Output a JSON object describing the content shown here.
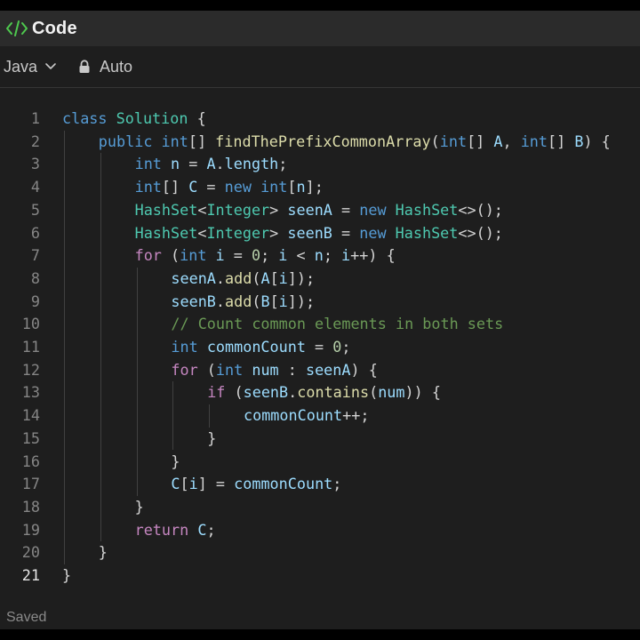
{
  "window": {
    "title": "Code",
    "icon": "code-brackets-icon"
  },
  "toolbar": {
    "language": "Java",
    "mode_label": "Auto",
    "lock_icon": "lock-icon",
    "chevron_icon": "chevron-down-icon"
  },
  "editor": {
    "active_line": 21,
    "lines": [
      {
        "n": "1",
        "indent": 0,
        "tokens": [
          [
            "kw",
            "class"
          ],
          [
            "plain",
            " "
          ],
          [
            "ty",
            "Solution"
          ],
          [
            "plain",
            " {"
          ]
        ]
      },
      {
        "n": "2",
        "indent": 1,
        "tokens": [
          [
            "kw",
            "public"
          ],
          [
            "plain",
            " "
          ],
          [
            "kw",
            "int"
          ],
          [
            "plain",
            "[] "
          ],
          [
            "fn",
            "findThePrefixCommonArray"
          ],
          [
            "plain",
            "("
          ],
          [
            "kw",
            "int"
          ],
          [
            "plain",
            "[] "
          ],
          [
            "var",
            "A"
          ],
          [
            "plain",
            ", "
          ],
          [
            "kw",
            "int"
          ],
          [
            "plain",
            "[] "
          ],
          [
            "var",
            "B"
          ],
          [
            "plain",
            ") {"
          ]
        ]
      },
      {
        "n": "3",
        "indent": 2,
        "tokens": [
          [
            "kw",
            "int"
          ],
          [
            "plain",
            " "
          ],
          [
            "var",
            "n"
          ],
          [
            "plain",
            " = "
          ],
          [
            "var",
            "A"
          ],
          [
            "plain",
            "."
          ],
          [
            "var",
            "length"
          ],
          [
            "plain",
            ";"
          ]
        ]
      },
      {
        "n": "4",
        "indent": 2,
        "tokens": [
          [
            "kw",
            "int"
          ],
          [
            "plain",
            "[] "
          ],
          [
            "var",
            "C"
          ],
          [
            "plain",
            " = "
          ],
          [
            "kw",
            "new"
          ],
          [
            "plain",
            " "
          ],
          [
            "kw",
            "int"
          ],
          [
            "plain",
            "["
          ],
          [
            "var",
            "n"
          ],
          [
            "plain",
            "];"
          ]
        ]
      },
      {
        "n": "5",
        "indent": 2,
        "tokens": [
          [
            "ty",
            "HashSet"
          ],
          [
            "plain",
            "<"
          ],
          [
            "ty",
            "Integer"
          ],
          [
            "plain",
            "> "
          ],
          [
            "var",
            "seenA"
          ],
          [
            "plain",
            " = "
          ],
          [
            "kw",
            "new"
          ],
          [
            "plain",
            " "
          ],
          [
            "ty",
            "HashSet"
          ],
          [
            "plain",
            "<>();"
          ]
        ]
      },
      {
        "n": "6",
        "indent": 2,
        "tokens": [
          [
            "ty",
            "HashSet"
          ],
          [
            "plain",
            "<"
          ],
          [
            "ty",
            "Integer"
          ],
          [
            "plain",
            "> "
          ],
          [
            "var",
            "seenB"
          ],
          [
            "plain",
            " = "
          ],
          [
            "kw",
            "new"
          ],
          [
            "plain",
            " "
          ],
          [
            "ty",
            "HashSet"
          ],
          [
            "plain",
            "<>();"
          ]
        ]
      },
      {
        "n": "7",
        "indent": 2,
        "tokens": [
          [
            "ctl",
            "for"
          ],
          [
            "plain",
            " ("
          ],
          [
            "kw",
            "int"
          ],
          [
            "plain",
            " "
          ],
          [
            "var",
            "i"
          ],
          [
            "plain",
            " = "
          ],
          [
            "num",
            "0"
          ],
          [
            "plain",
            "; "
          ],
          [
            "var",
            "i"
          ],
          [
            "plain",
            " < "
          ],
          [
            "var",
            "n"
          ],
          [
            "plain",
            "; "
          ],
          [
            "var",
            "i"
          ],
          [
            "plain",
            "++) {"
          ]
        ]
      },
      {
        "n": "8",
        "indent": 3,
        "tokens": [
          [
            "var",
            "seenA"
          ],
          [
            "plain",
            "."
          ],
          [
            "fn",
            "add"
          ],
          [
            "plain",
            "("
          ],
          [
            "var",
            "A"
          ],
          [
            "plain",
            "["
          ],
          [
            "var",
            "i"
          ],
          [
            "plain",
            "]);"
          ]
        ]
      },
      {
        "n": "9",
        "indent": 3,
        "tokens": [
          [
            "var",
            "seenB"
          ],
          [
            "plain",
            "."
          ],
          [
            "fn",
            "add"
          ],
          [
            "plain",
            "("
          ],
          [
            "var",
            "B"
          ],
          [
            "plain",
            "["
          ],
          [
            "var",
            "i"
          ],
          [
            "plain",
            "]);"
          ]
        ]
      },
      {
        "n": "10",
        "indent": 3,
        "tokens": [
          [
            "com",
            "// Count common elements in both sets"
          ]
        ]
      },
      {
        "n": "11",
        "indent": 3,
        "tokens": [
          [
            "kw",
            "int"
          ],
          [
            "plain",
            " "
          ],
          [
            "var",
            "commonCount"
          ],
          [
            "plain",
            " = "
          ],
          [
            "num",
            "0"
          ],
          [
            "plain",
            ";"
          ]
        ]
      },
      {
        "n": "12",
        "indent": 3,
        "tokens": [
          [
            "ctl",
            "for"
          ],
          [
            "plain",
            " ("
          ],
          [
            "kw",
            "int"
          ],
          [
            "plain",
            " "
          ],
          [
            "var",
            "num"
          ],
          [
            "plain",
            " : "
          ],
          [
            "var",
            "seenA"
          ],
          [
            "plain",
            ") {"
          ]
        ]
      },
      {
        "n": "13",
        "indent": 4,
        "tokens": [
          [
            "ctl",
            "if"
          ],
          [
            "plain",
            " ("
          ],
          [
            "var",
            "seenB"
          ],
          [
            "plain",
            "."
          ],
          [
            "fn",
            "contains"
          ],
          [
            "plain",
            "("
          ],
          [
            "var",
            "num"
          ],
          [
            "plain",
            ")) {"
          ]
        ]
      },
      {
        "n": "14",
        "indent": 5,
        "tokens": [
          [
            "var",
            "commonCount"
          ],
          [
            "plain",
            "++;"
          ]
        ]
      },
      {
        "n": "15",
        "indent": 4,
        "tokens": [
          [
            "plain",
            "}"
          ]
        ]
      },
      {
        "n": "16",
        "indent": 3,
        "tokens": [
          [
            "plain",
            "}"
          ]
        ]
      },
      {
        "n": "17",
        "indent": 3,
        "tokens": [
          [
            "var",
            "C"
          ],
          [
            "plain",
            "["
          ],
          [
            "var",
            "i"
          ],
          [
            "plain",
            "] = "
          ],
          [
            "var",
            "commonCount"
          ],
          [
            "plain",
            ";"
          ]
        ]
      },
      {
        "n": "18",
        "indent": 2,
        "tokens": [
          [
            "plain",
            "}"
          ]
        ]
      },
      {
        "n": "19",
        "indent": 2,
        "tokens": [
          [
            "ctl",
            "return"
          ],
          [
            "plain",
            " "
          ],
          [
            "var",
            "C"
          ],
          [
            "plain",
            ";"
          ]
        ]
      },
      {
        "n": "20",
        "indent": 1,
        "tokens": [
          [
            "plain",
            "}"
          ]
        ]
      },
      {
        "n": "21",
        "indent": 0,
        "tokens": [
          [
            "plain",
            "}"
          ]
        ]
      }
    ]
  },
  "status": {
    "text": "Saved"
  },
  "colors": {
    "keyword": "#569cd6",
    "control": "#c586c0",
    "type": "#4ec9b0",
    "function": "#dcdcaa",
    "variable": "#9cdcfe",
    "number": "#b5cea8",
    "comment": "#6a9955",
    "text": "#d4d4d4"
  }
}
